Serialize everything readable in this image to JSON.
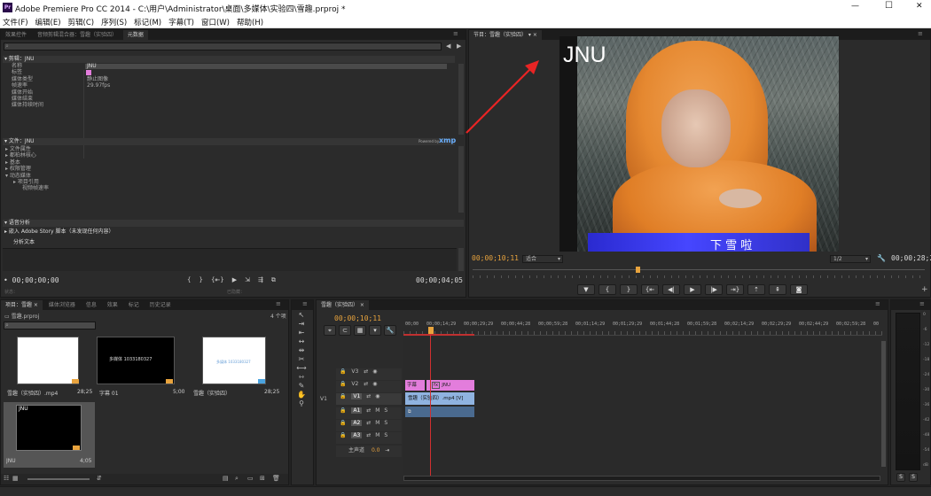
{
  "window": {
    "title": "Adobe Premiere Pro CC 2014 - C:\\用户\\Administrator\\桌面\\多媒体\\实验四\\雪趣.prproj *",
    "minimize": "—",
    "maximize": "☐",
    "close": "✕"
  },
  "menu": [
    "文件(F)",
    "编辑(E)",
    "剪辑(C)",
    "序列(S)",
    "标记(M)",
    "字幕(T)",
    "窗口(W)",
    "帮助(H)"
  ],
  "source_panel": {
    "tabs": [
      "效果控件",
      "音频剪辑混合器：雪趣（实验四）",
      "元数据"
    ],
    "clip_section_title": "剪辑：JNU",
    "clip_rows": [
      {
        "label": "名称",
        "value": "JNU"
      },
      {
        "label": "标签",
        "value": ""
      },
      {
        "label": "媒体类型",
        "value": "静止图像"
      },
      {
        "label": "帧速率",
        "value": "29.97fps"
      },
      {
        "label": "媒体开始",
        "value": ""
      },
      {
        "label": "媒体结束",
        "value": ""
      },
      {
        "label": "媒体持续时间",
        "value": ""
      }
    ],
    "file_section_title": "文件：JNU",
    "xmp_badge": "xmp",
    "xmp_prefix": "Powered by",
    "file_rows": [
      "文件属性",
      "都柏林核心",
      "基本",
      "权限管理",
      "动态媒体",
      "项目引用",
      "视频帧速率"
    ],
    "speech_title": "语音分析",
    "speech_embed": "嵌入 Adobe Story 脚本（未发现任何内容）",
    "analysis_text": "分析文本",
    "timecode_left": "00;00;00;00",
    "timecode_right": "00;00;04;05",
    "status_left": "状态：",
    "status_mid": "已隐藏："
  },
  "program_monitor": {
    "tab": "节目：雪趣（实验四）",
    "overlay_text": "JNU",
    "subtitle": "下 雪 啦",
    "timecode_left": "00;00;10;11",
    "timecode_right": "00;00;28;25",
    "fit": "适合",
    "quality": "1/2"
  },
  "project_panel": {
    "tabs": [
      "项目：雪趣",
      "媒体浏览器",
      "信息",
      "效果",
      "标记",
      "历史记录"
    ],
    "project_file": "雪趣.prproj",
    "item_count": "4 个项",
    "items": [
      {
        "name": "雪趣（实验四）.mp4",
        "duration": "28;25"
      },
      {
        "name": "字幕 01",
        "duration": "5;00"
      },
      {
        "name": "雪趣（实验四）",
        "duration": "28;25"
      },
      {
        "name": "JNU",
        "duration": "4;05"
      }
    ],
    "thumb_text_1": "多媒体 1033180327",
    "thumb_text_2": "多媒体 1033180327",
    "thumb_text_3": "JNU"
  },
  "timeline": {
    "tab": "雪趣（实验四）",
    "timecode": "00;00;10;11",
    "ruler": [
      "00;00",
      "00;00;14;29",
      "00;00;29;29",
      "00;00;44;28",
      "00;00;59;28",
      "00;01;14;29",
      "00;01;29;29",
      "00;01;44;28",
      "00;01;59;28",
      "00;02;14;29",
      "00;02;29;29",
      "00;02;44;29",
      "00;02;59;28",
      "00"
    ],
    "video_tracks": [
      "V3",
      "V2",
      "V1"
    ],
    "audio_tracks": [
      "A1",
      "A2",
      "A3"
    ],
    "source_patch": "V1",
    "master_label": "主声道",
    "master_value": "0.0",
    "clip_title": "字幕",
    "clip_jnu": "JNU",
    "clip_video": "雪趣（实验四）.mp4 [V]"
  },
  "meter": {
    "labels": [
      "0",
      "-6",
      "-12",
      "-18",
      "-24",
      "-30",
      "-36",
      "-42",
      "-48",
      "-54",
      "dB"
    ],
    "solo": "S"
  },
  "colors": {
    "timecode": "#e8a33d",
    "clip_title": "#e37ddc",
    "clip_video": "#8fb3e0",
    "playhead": "#d03030"
  }
}
